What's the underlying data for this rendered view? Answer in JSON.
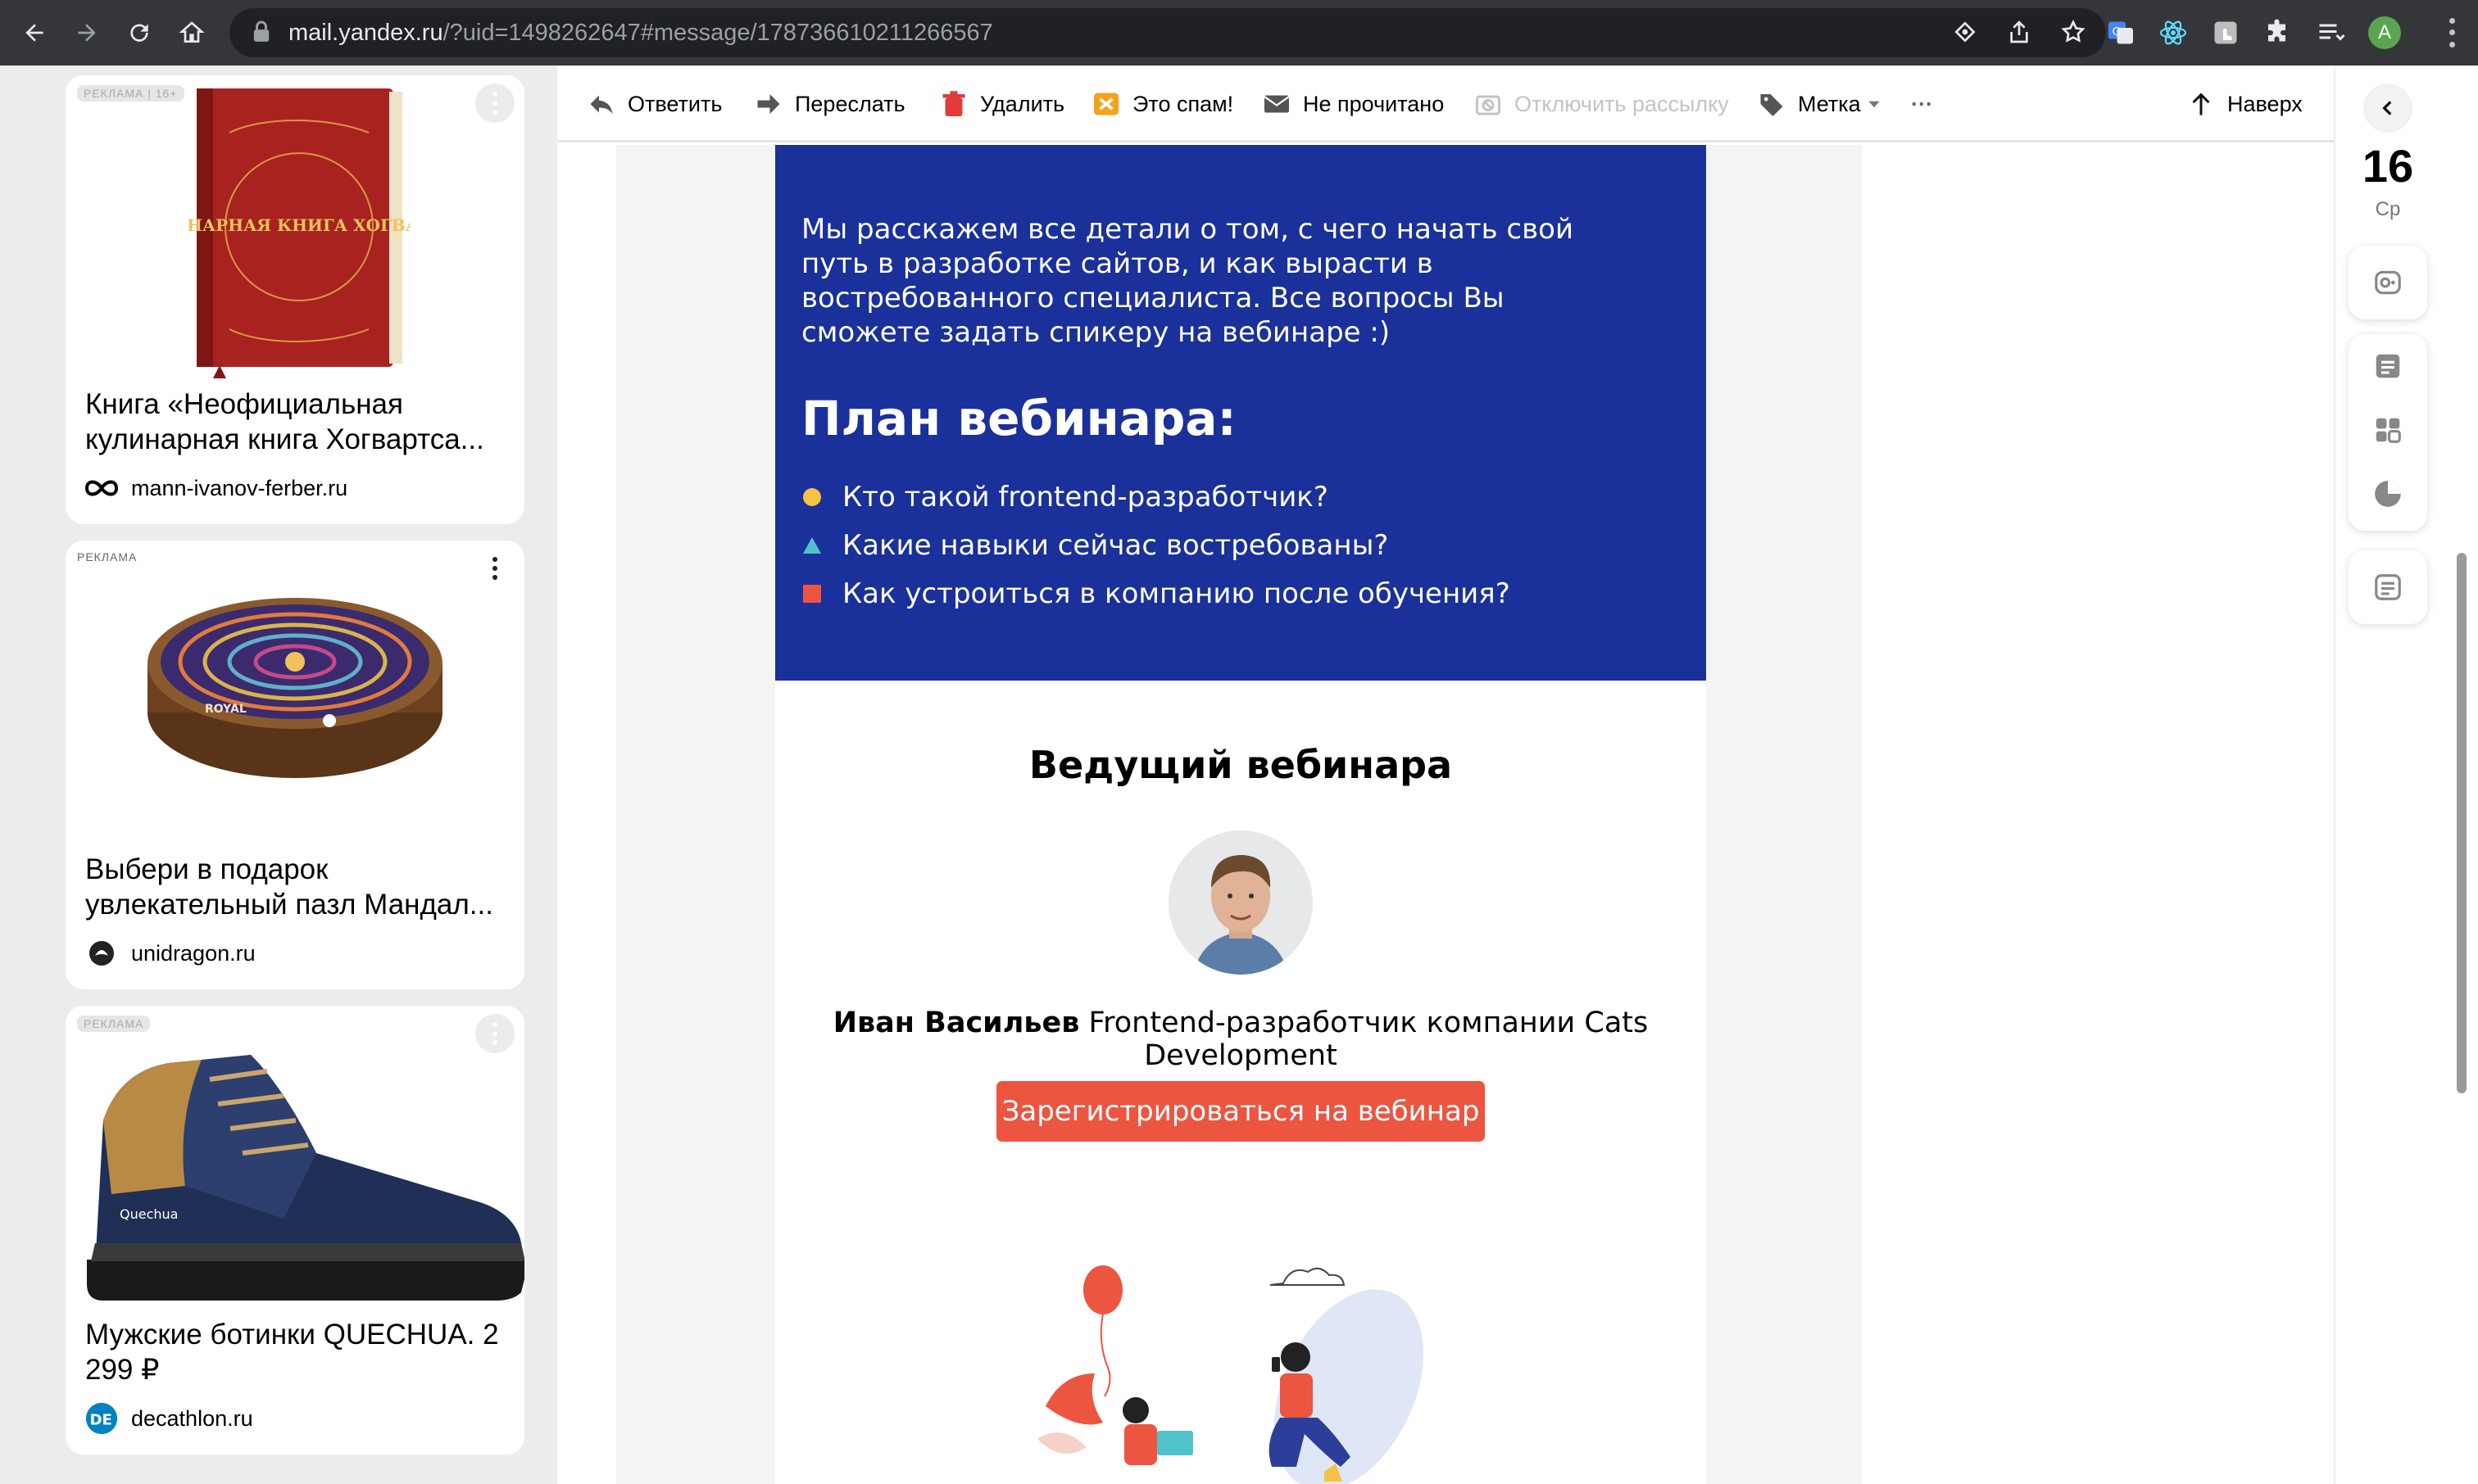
{
  "browser": {
    "url_host": "mail.yandex.ru",
    "url_rest": "/?uid=1498262647#message/178736610211266567",
    "profile_initial": "A"
  },
  "ads": [
    {
      "tag": "РЕКЛАМА | 16+",
      "title": "Книга «Неофициальная кулинарная книга Хогвартса...",
      "source": "mann-ivanov-ferber.ru",
      "image_caption": "КУЛИНАРНАЯ КНИГА ХОГВАРТСА"
    },
    {
      "tag": "РЕКЛАМА",
      "title": "Выбери в подарок увлекательный пазл Мандал...",
      "source": "unidragon.ru",
      "image_caption": "ROYAL"
    },
    {
      "tag": "РЕКЛАМА",
      "title": "Мужские ботинки QUECHUA. 2 299 ₽",
      "source": "decathlon.ru",
      "logo_text": "DE"
    }
  ],
  "toolbar": {
    "reply": "Ответить",
    "forward": "Переслать",
    "delete": "Удалить",
    "spam": "Это спам!",
    "unread": "Не прочитано",
    "unsubscribe": "Отключить рассылку",
    "label": "Метка",
    "more": "···",
    "up": "Наверх"
  },
  "letter": {
    "intro": "Мы расскажем все детали о том, с чего начать свой путь в разработке сайтов, и как вырасти в востребованного специалиста. Все вопросы Вы сможете задать спикеру на вебинаре :)",
    "plan_title": "План вебинара:",
    "plan_items": [
      {
        "text": "Кто такой frontend-разработчик?",
        "bullet": "circle",
        "color": "#f5c242"
      },
      {
        "text": "Какие навыки сейчас востребованы?",
        "bullet": "triangle",
        "color": "#4fc3c9"
      },
      {
        "text": "Как устроиться в компанию после обучения?",
        "bullet": "square",
        "color": "#ec5540"
      }
    ],
    "host_title": "Ведущий вебинара",
    "host_name": "Иван Васильев",
    "host_role": "Frontend-разработчик компании Cats Development",
    "cta": "Зарегистрироваться на вебинар"
  },
  "rail": {
    "date": "16",
    "weekday": "Ср",
    "icons": [
      "calendar-icon",
      "notes-icon",
      "services-icon",
      "disk-icon",
      "tasks-icon"
    ]
  },
  "colors": {
    "letter_blue": "#1a309a",
    "cta_red": "#ec5540",
    "chrome_dark": "#35363a"
  }
}
